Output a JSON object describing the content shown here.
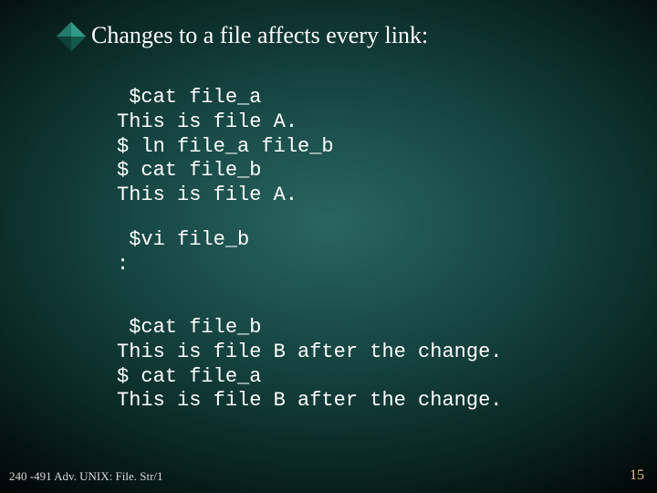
{
  "title": "Changes to a file affects every link:",
  "code1": " $cat file_a\nThis is file A.\n$ ln file_a file_b\n$ cat file_b\nThis is file A.",
  "code2": " $vi file_b\n:",
  "code3": " $cat file_b\nThis is file B after the change.\n$ cat file_a\nThis is file B after the change.",
  "footer_left": "240 -491 Adv. UNIX: File. Str/1",
  "footer_right": "15"
}
